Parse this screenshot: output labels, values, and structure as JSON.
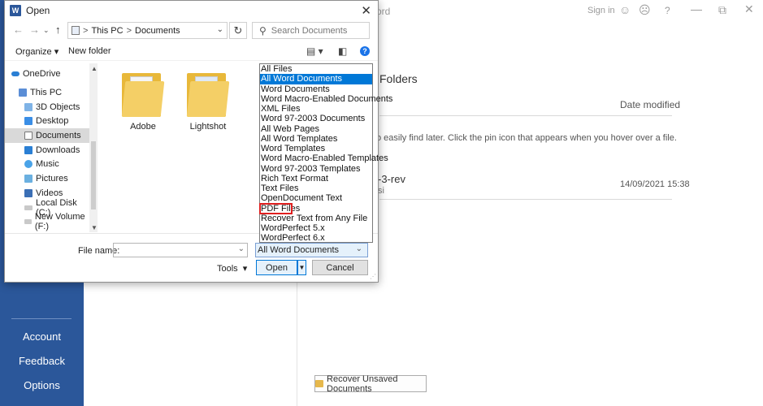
{
  "background": {
    "title_fragment": "ord",
    "sign_in": "Sign in",
    "smile_icon": "☺",
    "frown_icon": "☹",
    "help_icon": "?",
    "folders_heading": "Folders",
    "date_modified": "Date modified",
    "hint": "o easily find later. Click the pin icon that appears when you hover over a file.",
    "file_name": "-3-rev",
    "file_location": "si",
    "file_date": "14/09/2021 15:38",
    "left_nav": [
      "Account",
      "Feedback",
      "Options"
    ],
    "recover_button": "Recover Unsaved Documents",
    "accent_color": "#2b579a"
  },
  "dialog": {
    "title": "Open",
    "logo_letter": "W",
    "address": {
      "parts": [
        "This PC",
        "Documents"
      ],
      "separator": ">"
    },
    "search_placeholder": "Search Documents",
    "toolbar": {
      "organize": "Organize",
      "new_folder": "New folder"
    },
    "nav_items": [
      {
        "label": "OneDrive",
        "icon": "onedrive-icon"
      },
      {
        "label": "This PC",
        "icon": "pc-icon"
      },
      {
        "label": "3D Objects",
        "icon": "cube-icon"
      },
      {
        "label": "Desktop",
        "icon": "desktop-icon"
      },
      {
        "label": "Documents",
        "icon": "documents-icon",
        "selected": true
      },
      {
        "label": "Downloads",
        "icon": "download-icon"
      },
      {
        "label": "Music",
        "icon": "music-icon"
      },
      {
        "label": "Pictures",
        "icon": "pictures-icon"
      },
      {
        "label": "Videos",
        "icon": "videos-icon"
      },
      {
        "label": "Local Disk (C:)",
        "icon": "disk-icon"
      },
      {
        "label": "New Volume (F:)",
        "icon": "disk-icon"
      }
    ],
    "folders": [
      "Adobe",
      "Lightshot"
    ],
    "file_name_label": "File name:",
    "file_name_value": "",
    "file_type_selected": "All Word Documents",
    "file_types": [
      "All Files",
      "All Word Documents",
      "Word Documents",
      "Word Macro-Enabled Documents",
      "XML Files",
      "Word 97-2003 Documents",
      "All Web Pages",
      "All Word Templates",
      "Word Templates",
      "Word Macro-Enabled Templates",
      "Word 97-2003 Templates",
      "Rich Text Format",
      "Text Files",
      "OpenDocument Text",
      "PDF Files",
      "Recover Text from Any File",
      "WordPerfect 5.x",
      "WordPerfect 6.x"
    ],
    "highlighted_type": "PDF Files",
    "tools_label": "Tools",
    "open_label": "Open",
    "cancel_label": "Cancel"
  }
}
